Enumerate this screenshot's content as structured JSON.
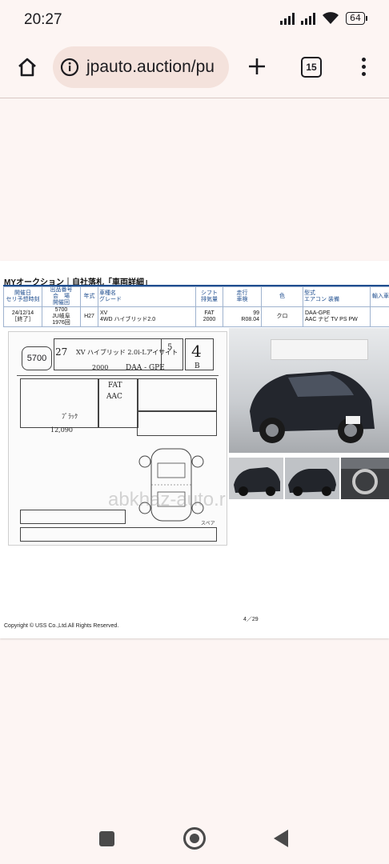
{
  "status_bar": {
    "time": "20:27",
    "battery": "64"
  },
  "browser": {
    "url": "jpauto.auction/pu",
    "tab_count": "15"
  },
  "document": {
    "title": "MYオークション｜自社落札「車両詳細」",
    "table_headers": [
      "開催日\nセリ予想時刻",
      "出品番号\n会　場\n開催回",
      "年式",
      "車種名\nグレード",
      "シフト\n排気量",
      "走行\n車検",
      "色",
      "型式\nエアコン 装備",
      "輸入車"
    ],
    "row": {
      "date": "24/12/14",
      "status": "［終了］",
      "lot": "5700",
      "venue": "JU岐阜",
      "session": "1976回",
      "year": "H27",
      "model": "XV",
      "grade": "4WD ハイブリッド2.0",
      "shift": "FAT",
      "displacement": "2000",
      "mileage": "99",
      "inspection": "R08.04",
      "color": "クロ",
      "type": "DAA-GPE",
      "equipment": "AAC ナビ TV PS PW"
    },
    "sheet": {
      "lot": "5700",
      "model_hw": "XV ハイブリッド 2.0i-Lアイサイト",
      "year_hw": "27",
      "score": "4",
      "doors": "5",
      "grade_letter": "B",
      "type_hw": "DAA - GPE",
      "cc_hw": "2000",
      "shift_hw": "FAT",
      "ac_hw": "AAC",
      "color_hw": "ﾌﾞﾗｯｸ",
      "mileage_hw": "12,090",
      "watermark": "abkhaz-auto.ru",
      "spare_label": "スペア"
    },
    "footer_copyright": "Copyright © USS Co.,Ltd.All Rights Reserved.",
    "footer_page": "4／29"
  }
}
